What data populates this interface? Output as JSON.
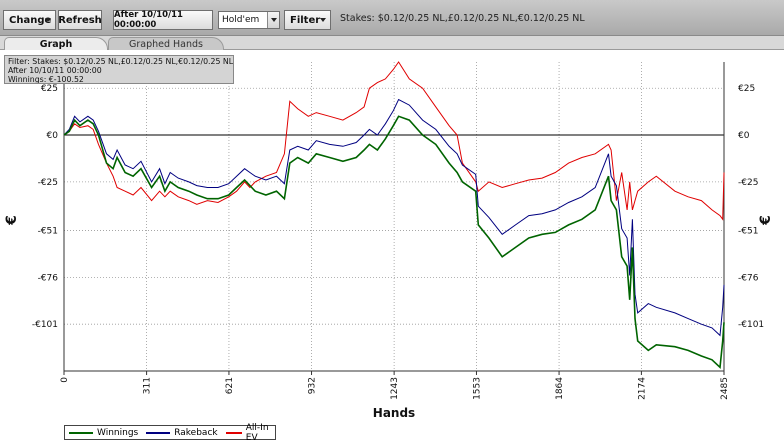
{
  "toolbar": {
    "change_label": "Change",
    "refresh_label": "Refresh",
    "date_label": "After 10/10/11 00:00:00",
    "game_select_value": "Hold'em",
    "filter_label": "Filter",
    "stakes_text": "Stakes: $0.12/0.25 NL,£0.12/0.25 NL,€0.12/0.25 NL"
  },
  "tabs": [
    {
      "label": "Graph",
      "active": true
    },
    {
      "label": "Graphed Hands",
      "active": false
    }
  ],
  "filter_box": {
    "line1": "Filter: Stakes: $0.12/0.25 NL,£0.12/0.25 NL,€0.12/0.25 NL",
    "line2": "After 10/10/11 00:00:00",
    "line3": "Winnings: €-100.52"
  },
  "colors": {
    "winnings": "#006400",
    "rakeback": "#000080",
    "allin_ev": "#e00000",
    "zero_line": "#000000",
    "grid": "#9a9a9a"
  },
  "chart_data": {
    "type": "line",
    "title": "",
    "xlabel": "Hands",
    "ylabel": "€",
    "xlim": [
      0,
      2485
    ],
    "ylim": [
      -126,
      39
    ],
    "x_ticks": [
      0,
      311,
      621,
      932,
      1243,
      1553,
      1864,
      2174,
      2485
    ],
    "y_ticks": [
      {
        "value": 25,
        "label": "€25"
      },
      {
        "value": 0,
        "label": "€0"
      },
      {
        "value": -25,
        "label": "-€25"
      },
      {
        "value": -51,
        "label": "-€51"
      },
      {
        "value": -76,
        "label": "-€76"
      },
      {
        "value": -101,
        "label": "-€101"
      }
    ],
    "grid": true,
    "legend_position": "bottom-left",
    "series": [
      {
        "name": "Winnings",
        "color": "#006400",
        "x": [
          0,
          20,
          40,
          60,
          90,
          110,
          130,
          160,
          185,
          200,
          230,
          260,
          290,
          330,
          360,
          380,
          400,
          430,
          470,
          500,
          540,
          580,
          620,
          650,
          680,
          700,
          720,
          760,
          800,
          830,
          850,
          880,
          920,
          950,
          1000,
          1050,
          1100,
          1130,
          1150,
          1180,
          1210,
          1240,
          1260,
          1300,
          1350,
          1400,
          1450,
          1480,
          1500,
          1550,
          1560,
          1600,
          1650,
          1700,
          1750,
          1800,
          1850,
          1900,
          1950,
          2000,
          2050,
          2060,
          2080,
          2100,
          2120,
          2130,
          2140,
          2150,
          2160,
          2200,
          2230,
          2300,
          2350,
          2400,
          2440,
          2470,
          2480,
          2485
        ],
        "y": [
          0,
          2,
          8,
          5,
          8,
          6,
          0,
          -15,
          -18,
          -12,
          -20,
          -22,
          -18,
          -28,
          -22,
          -30,
          -25,
          -28,
          -30,
          -32,
          -34,
          -34,
          -32,
          -28,
          -24,
          -27,
          -30,
          -32,
          -30,
          -34,
          -15,
          -12,
          -15,
          -10,
          -12,
          -14,
          -12,
          -8,
          -5,
          -8,
          -2,
          5,
          10,
          8,
          0,
          -5,
          -15,
          -20,
          -25,
          -30,
          -48,
          -55,
          -65,
          -60,
          -55,
          -53,
          -52,
          -48,
          -45,
          -40,
          -22,
          -35,
          -40,
          -65,
          -70,
          -88,
          -60,
          -98,
          -110,
          -115,
          -112,
          -113,
          -115,
          -118,
          -120,
          -124,
          -110,
          -100
        ]
      },
      {
        "name": "Rakeback",
        "color": "#000080",
        "x": [
          0,
          20,
          40,
          60,
          90,
          110,
          130,
          160,
          185,
          200,
          230,
          260,
          290,
          330,
          360,
          380,
          400,
          430,
          470,
          500,
          540,
          580,
          620,
          650,
          680,
          700,
          720,
          760,
          800,
          830,
          850,
          880,
          920,
          950,
          1000,
          1050,
          1100,
          1130,
          1150,
          1180,
          1210,
          1240,
          1260,
          1300,
          1350,
          1400,
          1450,
          1480,
          1500,
          1550,
          1560,
          1600,
          1650,
          1700,
          1750,
          1800,
          1850,
          1900,
          1950,
          2000,
          2050,
          2060,
          2080,
          2100,
          2120,
          2130,
          2140,
          2150,
          2160,
          2200,
          2230,
          2300,
          2350,
          2400,
          2440,
          2470,
          2480,
          2485
        ],
        "y": [
          0,
          3,
          10,
          7,
          10,
          8,
          2,
          -10,
          -13,
          -8,
          -16,
          -18,
          -14,
          -25,
          -18,
          -26,
          -20,
          -23,
          -25,
          -27,
          -28,
          -28,
          -26,
          -22,
          -18,
          -20,
          -22,
          -24,
          -22,
          -26,
          -8,
          -6,
          -8,
          -3,
          -5,
          -6,
          -4,
          0,
          3,
          0,
          6,
          13,
          19,
          16,
          8,
          3,
          -6,
          -10,
          -16,
          -21,
          -38,
          -44,
          -53,
          -48,
          -43,
          -42,
          -40,
          -36,
          -33,
          -28,
          -10,
          -22,
          -27,
          -50,
          -55,
          -75,
          -45,
          -85,
          -95,
          -90,
          -92,
          -95,
          -98,
          -101,
          -103,
          -107,
          -92,
          -80
        ]
      },
      {
        "name": "All-In EV",
        "color": "#e00000",
        "x": [
          0,
          20,
          40,
          60,
          90,
          110,
          130,
          160,
          185,
          200,
          230,
          260,
          290,
          330,
          360,
          380,
          400,
          430,
          470,
          500,
          540,
          580,
          620,
          650,
          680,
          700,
          720,
          760,
          800,
          830,
          850,
          880,
          920,
          950,
          1000,
          1050,
          1100,
          1130,
          1150,
          1180,
          1210,
          1240,
          1260,
          1300,
          1350,
          1400,
          1450,
          1480,
          1500,
          1550,
          1560,
          1600,
          1650,
          1700,
          1750,
          1800,
          1850,
          1900,
          1950,
          2000,
          2050,
          2060,
          2080,
          2100,
          2120,
          2130,
          2140,
          2150,
          2160,
          2200,
          2230,
          2300,
          2350,
          2400,
          2440,
          2470,
          2480,
          2485
        ],
        "y": [
          0,
          2,
          6,
          4,
          5,
          3,
          -5,
          -15,
          -22,
          -28,
          -30,
          -32,
          -28,
          -35,
          -30,
          -33,
          -30,
          -33,
          -35,
          -37,
          -35,
          -36,
          -33,
          -30,
          -25,
          -28,
          -25,
          -22,
          -20,
          -10,
          18,
          14,
          10,
          12,
          10,
          8,
          12,
          15,
          25,
          28,
          30,
          35,
          39,
          30,
          25,
          15,
          5,
          0,
          -15,
          -25,
          -30,
          -25,
          -28,
          -26,
          -24,
          -23,
          -20,
          -15,
          -12,
          -10,
          -5,
          -8,
          -35,
          -20,
          -40,
          -25,
          -40,
          -35,
          -30,
          -25,
          -22,
          -30,
          -33,
          -35,
          -40,
          -43,
          -45,
          -20
        ]
      }
    ]
  }
}
